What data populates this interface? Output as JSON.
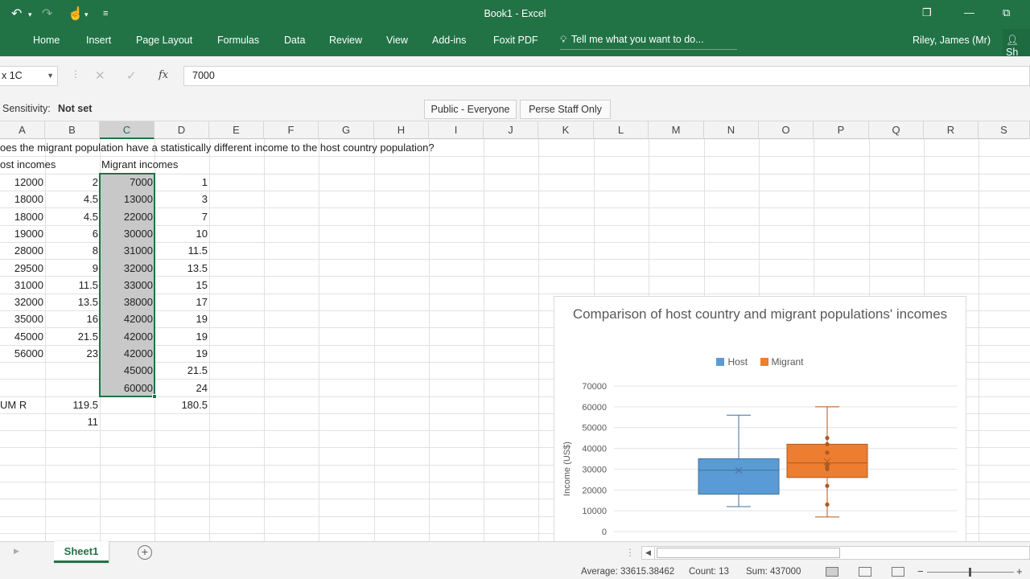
{
  "app": {
    "window_title": "Book1 - Excel",
    "user": "Riley, James (Mr)",
    "share_label": "Sh"
  },
  "ribbon": {
    "tabs": [
      "Home",
      "Insert",
      "Page Layout",
      "Formulas",
      "Data",
      "Review",
      "View",
      "Add-ins",
      "Foxit PDF"
    ],
    "tell_me": "Tell me what you want to do..."
  },
  "formula_bar": {
    "name_box": "x 1C",
    "formula": "7000",
    "fx_label": "fx"
  },
  "sensitivity": {
    "label": "Sensitivity:",
    "value": "Not set",
    "buttons": [
      "Public - Everyone",
      "Perse Staff Only"
    ]
  },
  "grid": {
    "columns": [
      "A",
      "B",
      "C",
      "D",
      "E",
      "F",
      "G",
      "H",
      "I",
      "J",
      "K",
      "L",
      "M",
      "N",
      "O",
      "P",
      "Q",
      "R",
      "S"
    ],
    "selected_column": "C",
    "question": "oes the migrant population have a statistically different income to the host country population?",
    "host_header": "ost incomes",
    "migrant_header": "Migrant incomes",
    "rows": [
      {
        "a": "12000",
        "b": "2",
        "c": "7000",
        "d": "1"
      },
      {
        "a": "18000",
        "b": "4.5",
        "c": "13000",
        "d": "3"
      },
      {
        "a": "18000",
        "b": "4.5",
        "c": "22000",
        "d": "7"
      },
      {
        "a": "19000",
        "b": "6",
        "c": "30000",
        "d": "10"
      },
      {
        "a": "28000",
        "b": "8",
        "c": "31000",
        "d": "11.5"
      },
      {
        "a": "29500",
        "b": "9",
        "c": "32000",
        "d": "13.5"
      },
      {
        "a": "31000",
        "b": "11.5",
        "c": "33000",
        "d": "15"
      },
      {
        "a": "32000",
        "b": "13.5",
        "c": "38000",
        "d": "17"
      },
      {
        "a": "35000",
        "b": "16",
        "c": "42000",
        "d": "19"
      },
      {
        "a": "45000",
        "b": "21.5",
        "c": "42000",
        "d": "19"
      },
      {
        "a": "56000",
        "b": "23",
        "c": "42000",
        "d": "19"
      },
      {
        "a": "",
        "b": "",
        "c": "45000",
        "d": "21.5"
      },
      {
        "a": "",
        "b": "",
        "c": "60000",
        "d": "24"
      }
    ],
    "sum_label": "UM R",
    "sum_b": "119.5",
    "sum_d": "180.5",
    "count_b": "11"
  },
  "chart_data": {
    "type": "box",
    "title": "Comparison of host country and migrant populations' incomes",
    "ylabel": "Income (US$)",
    "ylim": [
      0,
      70000
    ],
    "y_ticks": [
      "70000",
      "60000",
      "50000",
      "40000",
      "30000",
      "20000",
      "10000",
      "0"
    ],
    "legend_position": "top",
    "series": [
      {
        "name": "Host",
        "color": "#5B9BD5",
        "min": 12000,
        "q1": 18000,
        "median": 29500,
        "mean": 29409,
        "q3": 35000,
        "max": 56000,
        "outliers": []
      },
      {
        "name": "Migrant",
        "color": "#ED7D31",
        "min": 7000,
        "q1": 26000,
        "median": 33000,
        "mean": 33615,
        "q3": 42000,
        "max": 60000,
        "points": [
          13000,
          22000,
          30000,
          31000,
          32000,
          38000,
          42000,
          45000
        ]
      }
    ],
    "grid": true
  },
  "sheets": {
    "tabs": [
      "Sheet1"
    ],
    "active": "Sheet1"
  },
  "status": {
    "average": "Average: 33615.38462",
    "count": "Count: 13",
    "sum": "Sum: 437000"
  }
}
